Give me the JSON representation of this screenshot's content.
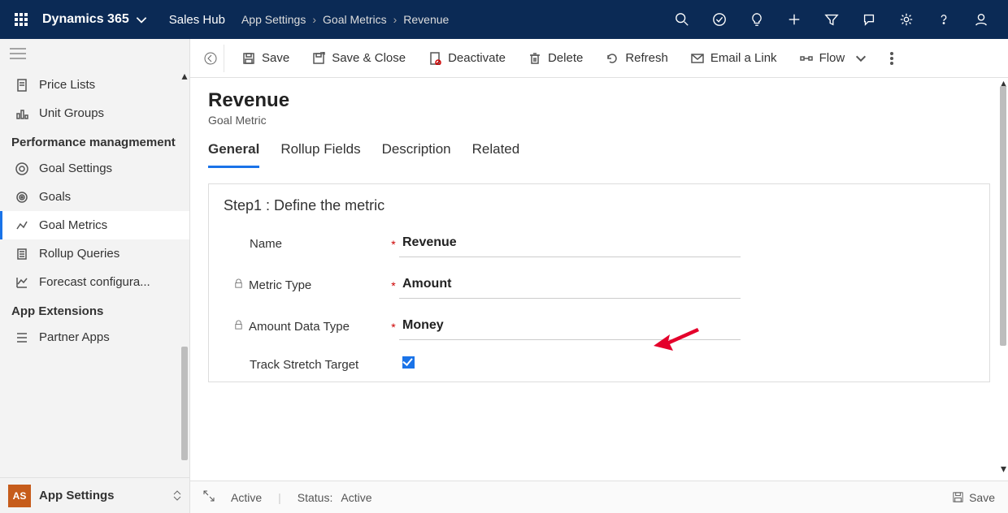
{
  "topbar": {
    "brand": "Dynamics 365",
    "area": "Sales Hub",
    "crumbs": [
      "App Settings",
      "Goal Metrics",
      "Revenue"
    ]
  },
  "sidebar": {
    "items": [
      {
        "label": "Price Lists"
      },
      {
        "label": "Unit Groups"
      }
    ],
    "group_perf": "Performance managmement",
    "perf_items": [
      {
        "label": "Goal Settings"
      },
      {
        "label": "Goals"
      },
      {
        "label": "Goal Metrics"
      },
      {
        "label": "Rollup Queries"
      },
      {
        "label": "Forecast configura..."
      }
    ],
    "group_ext": "App Extensions",
    "ext_items": [
      {
        "label": "Partner Apps"
      }
    ],
    "footer": {
      "initials": "AS",
      "label": "App Settings"
    }
  },
  "commandBar": {
    "save": "Save",
    "saveClose": "Save & Close",
    "deactivate": "Deactivate",
    "delete": "Delete",
    "refresh": "Refresh",
    "emailLink": "Email a Link",
    "flow": "Flow"
  },
  "record": {
    "title": "Revenue",
    "subtitle": "Goal Metric"
  },
  "tabs": {
    "general": "General",
    "rollup": "Rollup Fields",
    "description": "Description",
    "related": "Related"
  },
  "form": {
    "section_title": "Step1 : Define the metric",
    "name_label": "Name",
    "name_value": "Revenue",
    "metric_type_label": "Metric Type",
    "metric_type_value": "Amount",
    "amount_dt_label": "Amount Data Type",
    "amount_dt_value": "Money",
    "track_label": "Track Stretch Target"
  },
  "statusbar": {
    "state": "Active",
    "status_label": "Status:",
    "status_value": "Active",
    "save": "Save"
  }
}
